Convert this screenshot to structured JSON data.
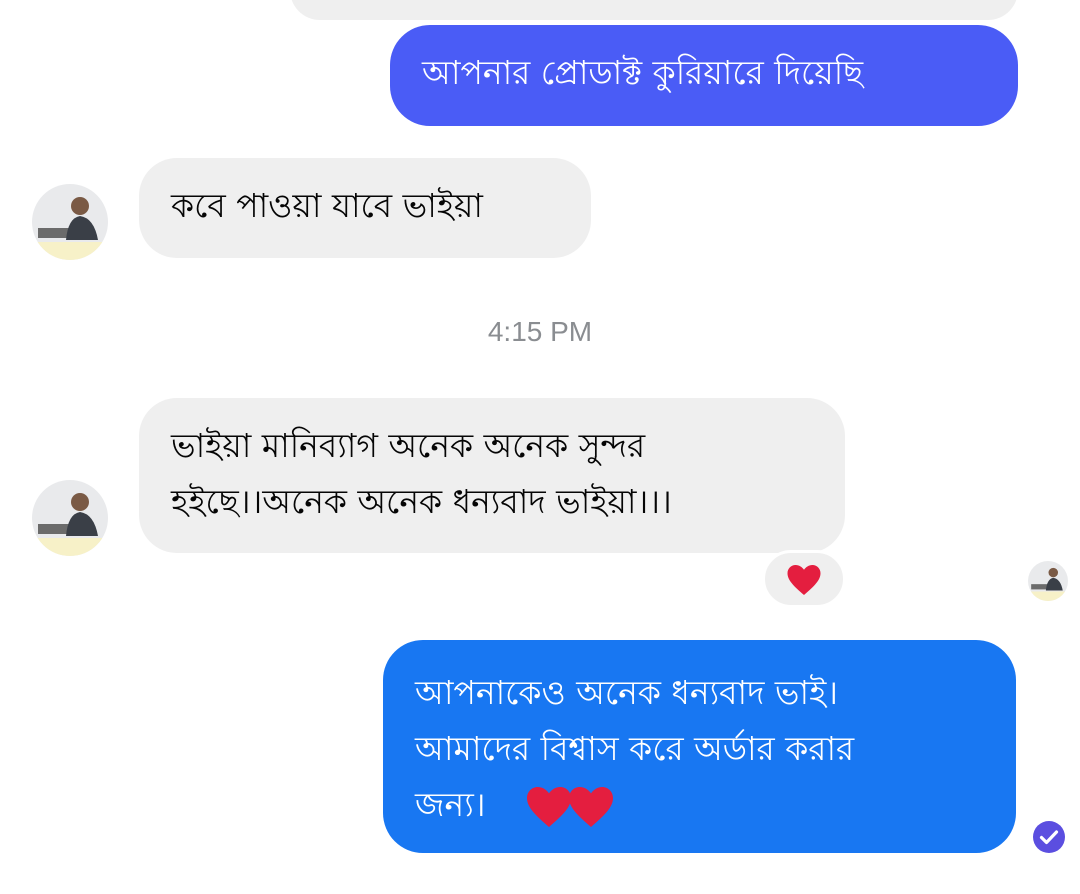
{
  "messages": [
    {
      "id": "m1",
      "direction": "outgoing",
      "text_lines": [
        "আপনার প্রোডাক্ট কুরিয়ারে দিয়েছি"
      ]
    },
    {
      "id": "m2",
      "direction": "incoming",
      "text_lines": [
        "কবে পাওয়া যাবে ভাইয়া"
      ]
    },
    {
      "id": "m3",
      "direction": "incoming",
      "text_lines": [
        "ভাইয়া মানিব্যাগ অনেক অনেক সুন্দর",
        "হইছে।।অনেক অনেক ধন্যবাদ ভাইয়া।।।"
      ],
      "reaction": "heart"
    },
    {
      "id": "m4",
      "direction": "outgoing",
      "text_lines": [
        "আপনাকেও অনেক ধন্যবাদ ভাই।",
        "আমাদের বিশ্বাস করে অর্ডার করার",
        "জন্য।"
      ],
      "trailing_emoji": [
        "heart",
        "heart"
      ]
    }
  ],
  "timestamp": "4:15 PM",
  "colors": {
    "incoming_bubble": "#efefef",
    "outgoing_bubble_top": "#4a5cf6",
    "outgoing_bubble_bottom": "#1877f2",
    "timestamp_text": "#8a8d91",
    "heart": "#e41e3f",
    "sent_check": "#5b4ee0"
  },
  "icons": {
    "reaction": "heart-icon",
    "read_receipt": "seen-avatar",
    "delivered": "check-circle-icon"
  }
}
